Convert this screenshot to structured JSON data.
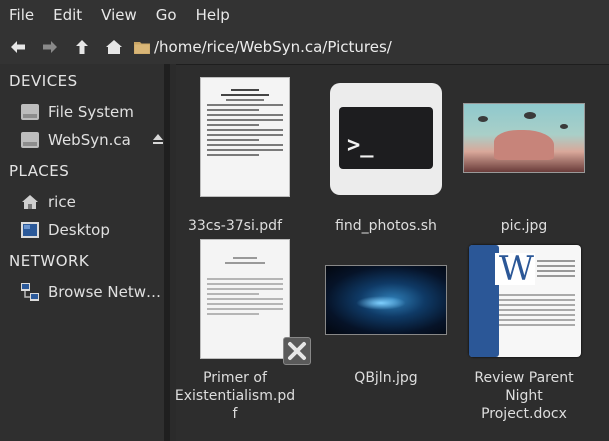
{
  "menu": [
    "File",
    "Edit",
    "View",
    "Go",
    "Help"
  ],
  "toolbar": {
    "path": "/home/rice/WebSyn.ca/Pictures/"
  },
  "sidebar": {
    "devices_heading": "DEVICES",
    "devices": [
      {
        "label": "File System",
        "icon": "drive-icon"
      },
      {
        "label": "WebSyn.ca",
        "icon": "drive-icon"
      }
    ],
    "places_heading": "PLACES",
    "places": [
      {
        "label": "rice",
        "icon": "home-icon"
      },
      {
        "label": "Desktop",
        "icon": "desktop-icon"
      }
    ],
    "network_heading": "NETWORK",
    "network": [
      {
        "label": "Browse Netw…",
        "icon": "network-icon"
      }
    ]
  },
  "files": [
    {
      "name": "33cs-37si.pdf",
      "type": "pdf"
    },
    {
      "name": "find_photos.sh",
      "type": "script"
    },
    {
      "name": "pic.jpg",
      "type": "image"
    },
    {
      "name_lines": [
        "Primer of",
        "Existentialism.pd",
        "f"
      ],
      "type": "pdf"
    },
    {
      "name": "QBjln.jpg",
      "type": "image"
    },
    {
      "name_lines": [
        "Review Parent",
        "Night",
        "Project.docx"
      ],
      "type": "docx"
    }
  ],
  "thumbnails": {
    "term_prompt": ">_",
    "word_letter": "W"
  },
  "colors": {
    "menubar": "#333333",
    "sidebar": "#2f2f2f",
    "main": "#2d2d2d",
    "word_blue": "#2b5797"
  }
}
